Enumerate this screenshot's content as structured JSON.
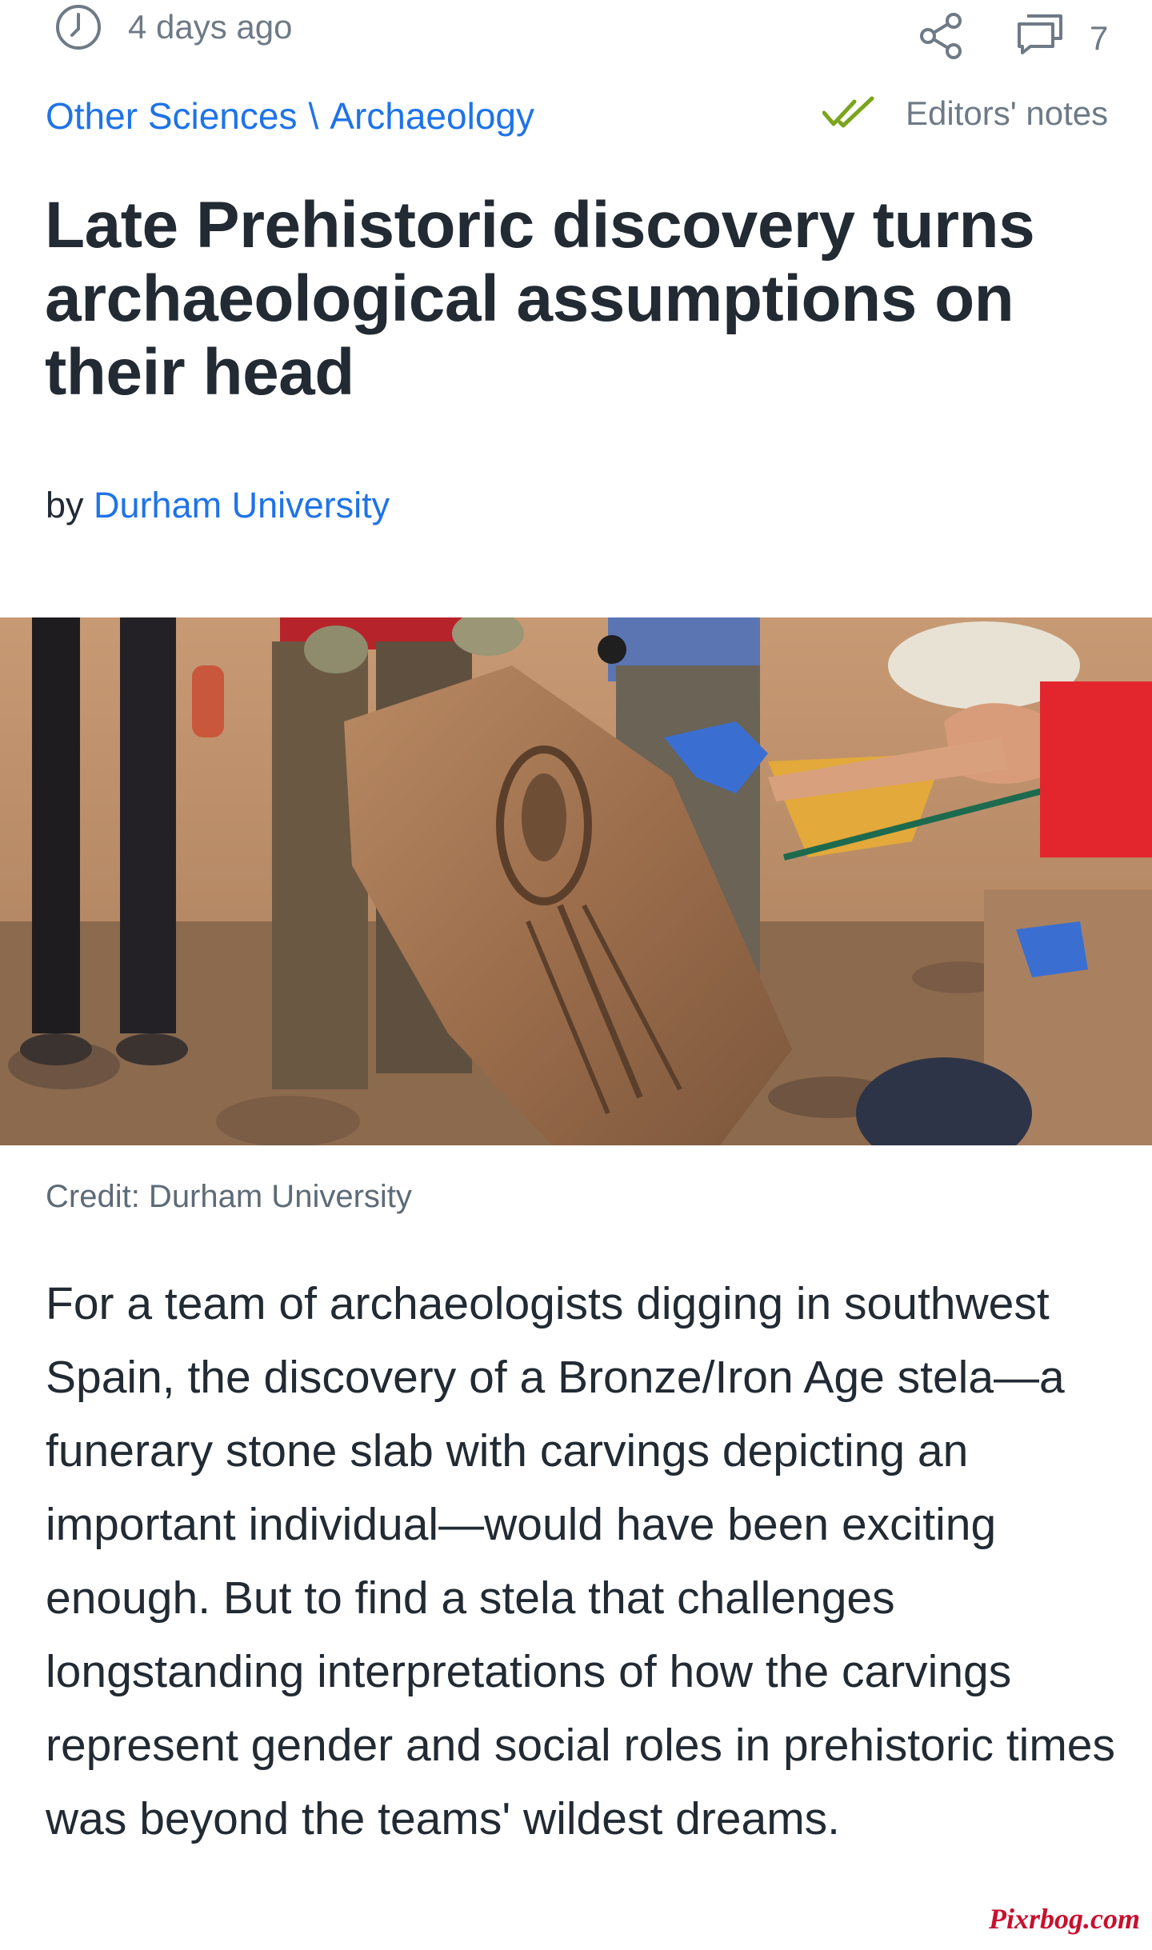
{
  "meta": {
    "time_ago": "4 days ago",
    "comments_count": "7"
  },
  "breadcrumb": {
    "category": "Other Sciences",
    "separator": "\\",
    "subcategory": "Archaeology"
  },
  "editors_notes": "Editors' notes",
  "article": {
    "title": "Late Prehistoric discovery turns archaeological assumptions on their head",
    "byline_prefix": "by",
    "author": "Durham University",
    "image_credit": "Credit: Durham University",
    "lead_paragraph": "For a team of archaeologists digging in southwest Spain, the discovery of a Bronze/Iron Age stela—a funerary stone slab with carvings depicting an important individual—would have been exciting enough. But to find a stela that challenges longstanding interpretations of how the carvings represent gender and social roles in prehistoric times was beyond the teams' wildest dreams."
  },
  "watermark": "Pixrbog.com",
  "icons": {
    "time": "clock-icon",
    "share": "share-icon",
    "comments": "comments-icon",
    "editors": "double-check-icon"
  },
  "colors": {
    "link": "#1f73e8",
    "muted": "#6e7a86",
    "text": "#222a33",
    "check": "#7aa51c",
    "watermark": "#c8102e"
  }
}
